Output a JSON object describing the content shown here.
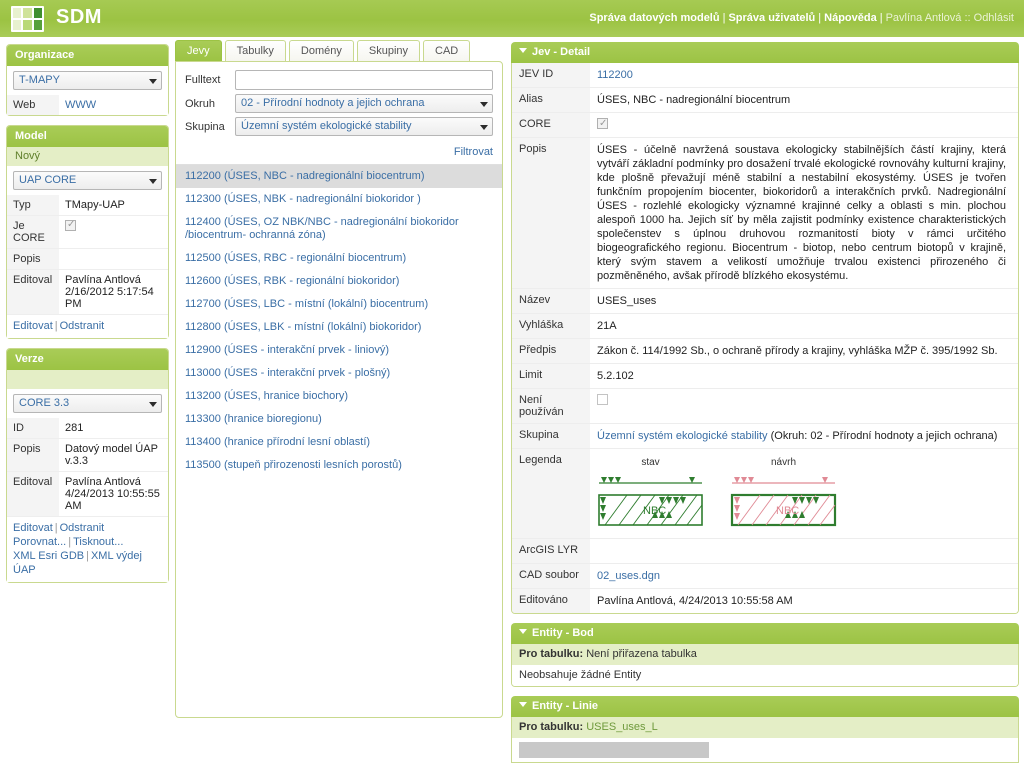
{
  "app": {
    "title": "SDM",
    "logo_icon": "grid-logo-icon"
  },
  "topnav": {
    "items": [
      {
        "label": "Správa datových modelů",
        "type": "link"
      },
      {
        "label": "Správa uživatelů",
        "type": "link"
      },
      {
        "label": "Nápověda",
        "type": "link"
      }
    ],
    "separator": "|",
    "user_text": "Pavlína Antlová :: Odhlásit"
  },
  "left": {
    "organizace": {
      "title": "Organizace",
      "select_value": "T-MAPY",
      "rows": [
        {
          "key": "Web",
          "value": "WWW",
          "is_link": true
        }
      ]
    },
    "model": {
      "title": "Model",
      "new_link": "Nový",
      "select_value": "UAP CORE",
      "rows": [
        {
          "key": "Typ",
          "value": "TMapy-UAP"
        },
        {
          "key": "Je CORE",
          "value": "",
          "checkbox": true,
          "checked": true
        },
        {
          "key": "Popis",
          "value": ""
        },
        {
          "key": "Editoval",
          "value": "Pavlína Antlová\n2/16/2012 5:17:54 PM"
        }
      ],
      "actions": [
        "Editovat",
        "Odstranit"
      ]
    },
    "verze": {
      "title": "Verze",
      "select_value": "CORE 3.3",
      "rows": [
        {
          "key": "ID",
          "value": "281"
        },
        {
          "key": "Popis",
          "value": "Datový model ÚAP v.3.3"
        },
        {
          "key": "Editoval",
          "value": "Pavlína Antlová\n4/24/2013 10:55:55 AM"
        }
      ],
      "actions_line1": [
        "Editovat",
        "Odstranit"
      ],
      "actions_line2": [
        "Porovnat...",
        "Tisknout..."
      ],
      "actions_line3": [
        "XML Esri GDB",
        "XML výdej ÚAP"
      ]
    }
  },
  "middle": {
    "tabs": [
      {
        "label": "Jevy",
        "active": true
      },
      {
        "label": "Tabulky",
        "active": false
      },
      {
        "label": "Domény",
        "active": false
      },
      {
        "label": "Skupiny",
        "active": false
      },
      {
        "label": "CAD",
        "active": false
      }
    ],
    "filter": {
      "fulltext_label": "Fulltext",
      "fulltext_value": "",
      "fulltext_placeholder": "",
      "okruh_label": "Okruh",
      "okruh_value": "02 - Přírodní hodnoty a jejich ochrana",
      "skupina_label": "Skupina",
      "skupina_value": "Územní systém ekologické stability",
      "submit_label": "Filtrovat"
    },
    "list": [
      {
        "label": "112200 (ÚSES, NBC - nadregionální biocentrum)",
        "selected": true
      },
      {
        "label": "112300 (ÚSES, NBK - nadregionální biokoridor )",
        "selected": false
      },
      {
        "label": "112400 (ÚSES, OZ NBK/NBC - nadregionální biokoridor /biocentrum- ochranná zóna)",
        "selected": false
      },
      {
        "label": "112500 (ÚSES, RBC - regionální biocentrum)",
        "selected": false
      },
      {
        "label": "112600 (ÚSES, RBK - regionální biokoridor)",
        "selected": false
      },
      {
        "label": "112700 (ÚSES, LBC - místní (lokální) biocentrum)",
        "selected": false
      },
      {
        "label": "112800 (ÚSES, LBK - místní (lokální) biokoridor)",
        "selected": false
      },
      {
        "label": "112900 (ÚSES - interakční prvek - liniový)",
        "selected": false
      },
      {
        "label": "113000 (ÚSES - interakční prvek - plošný)",
        "selected": false
      },
      {
        "label": "113200 (ÚSES, hranice biochory)",
        "selected": false
      },
      {
        "label": "113300 (hranice bioregionu)",
        "selected": false
      },
      {
        "label": "113400 (hranice přírodní lesní oblastí)",
        "selected": false
      },
      {
        "label": "113500 (stupeň přirozenosti lesních porostů)",
        "selected": false
      }
    ]
  },
  "detail": {
    "title": "Jev - Detail",
    "collapse_icon": "caret-down-icon",
    "jev_id_label": "JEV ID",
    "jev_id_value": "112200",
    "alias_label": "Alias",
    "alias_value": "ÚSES, NBC - nadregionální biocentrum",
    "core_label": "CORE",
    "core_checked": true,
    "popis_label": "Popis",
    "popis_value": "ÚSES - účelně navržená soustava ekologicky stabilnějších částí krajiny, která vytváří základní podmínky pro dosažení trvalé ekologické rovnováhy kulturní krajiny, kde plošně převažují méně stabilní a nestabilní ekosystémy. ÚSES je tvořen funkčním propojením biocenter, biokoridorů a interakčních prvků. Nadregionální ÚSES - rozlehlé ekologicky významné krajinné celky a oblasti s min. plochou alespoň 1000 ha. Jejich síť by měla zajistit podmínky existence charakteristických společenstev s úplnou druhovou rozmanitostí bioty v rámci určitého biogeografického regionu. Biocentrum - biotop, nebo centrum biotopů v krajině, který svým stavem a velikostí umožňuje trvalou existenci přirozeného či pozměněného, avšak přírodě blízkého ekosystému.",
    "nazev_label": "Název",
    "nazev_value": "USES_uses",
    "vyhlaska_label": "Vyhláška",
    "vyhlaska_value": "21A",
    "predpis_label": "Předpis",
    "predpis_value": "Zákon č. 114/1992 Sb., o ochraně přírody a krajiny, vyhláška MŽP č. 395/1992 Sb.",
    "limit_label": "Limit",
    "limit_value": "5.2.102",
    "neni_pouzivan_label": "Není používán",
    "neni_pouzivan_checked": false,
    "skupina_label": "Skupina",
    "skupina_link": "Územní systém ekologické stability",
    "skupina_suffix": " (Okruh: 02 - Přírodní hodnoty a jejich ochrana)",
    "legenda_label": "Legenda",
    "legenda": [
      {
        "caption": "stav",
        "swatch_label": "NBC",
        "color": "#2f7d2f"
      },
      {
        "caption": "návrh",
        "swatch_label": "NBC",
        "color": "#e08a95"
      }
    ],
    "arcgis_label": "ArcGIS LYR",
    "arcgis_value": "",
    "cad_label": "CAD soubor",
    "cad_value": "02_uses.dgn",
    "editovano_label": "Editováno",
    "editovano_value": "Pavlína Antlová, 4/24/2013 10:55:58 AM"
  },
  "entity_bod": {
    "title": "Entity - Bod",
    "collapse_icon": "caret-down-icon",
    "pro_tabulku_label": "Pro tabulku:",
    "pro_tabulku_value": "Není přiřazena tabulka",
    "empty_text": "Neobsahuje žádné Entity"
  },
  "entity_linie": {
    "title": "Entity - Linie",
    "collapse_icon": "caret-down-icon",
    "pro_tabulku_label": "Pro tabulku:",
    "pro_tabulku_value": "USES_uses_L"
  },
  "colors": {
    "brand_green": "#9cc344",
    "panel_border": "#c9d98f",
    "subbar": "#e4eec6",
    "link_blue": "#3a6ea5",
    "selected_row": "#dcdcdc"
  }
}
